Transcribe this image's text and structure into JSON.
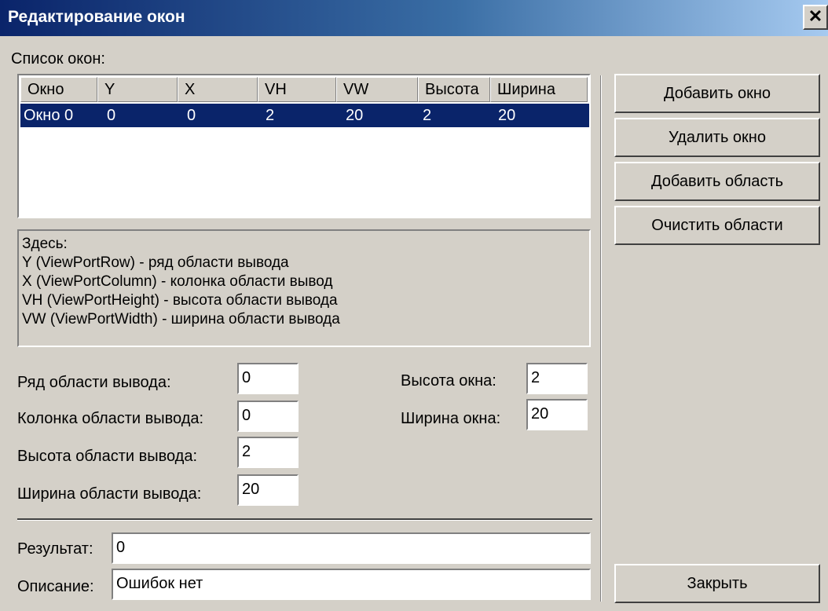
{
  "window": {
    "title": "Редактирование окон",
    "close_glyph": "✕"
  },
  "list": {
    "label": "Список окон:",
    "columns": [
      "Окно",
      "Y",
      "X",
      "VH",
      "VW",
      "Высота",
      "Ширина"
    ],
    "rows": [
      [
        "Окно 0",
        "0",
        "0",
        "2",
        "20",
        "2",
        "20"
      ]
    ]
  },
  "help": {
    "lines": [
      "Здесь:",
      "Y (ViewPortRow) - ряд области вывода",
      "X (ViewPortColumn) - колонка области вывод",
      "VH (ViewPortHeight) - высота области вывода",
      "VW (ViewPortWidth) - ширина области вывода"
    ]
  },
  "fields": {
    "viewport_row": {
      "label": "Ряд области вывода:",
      "value": "0"
    },
    "viewport_column": {
      "label": "Колонка области вывода:",
      "value": "0"
    },
    "viewport_height": {
      "label": "Высота области вывода:",
      "value": "2"
    },
    "viewport_width": {
      "label": "Ширина области вывода:",
      "value": "20"
    },
    "window_height": {
      "label": "Высота окна:",
      "value": "2"
    },
    "window_width": {
      "label": "Ширина окна:",
      "value": "20"
    },
    "result": {
      "label": "Результат:",
      "value": "0"
    },
    "description": {
      "label": "Описание:",
      "value": "Ошибок нет"
    }
  },
  "buttons": {
    "add_window": "Добавить окно",
    "delete_window": "Удалить окно",
    "add_area": "Добавить область",
    "clear_areas": "Очистить области",
    "close": "Закрыть"
  },
  "colors": {
    "title_gradient_start": "#0a246a",
    "title_gradient_end": "#a6caf0",
    "selection": "#0a246a",
    "face": "#d4d0c8"
  }
}
